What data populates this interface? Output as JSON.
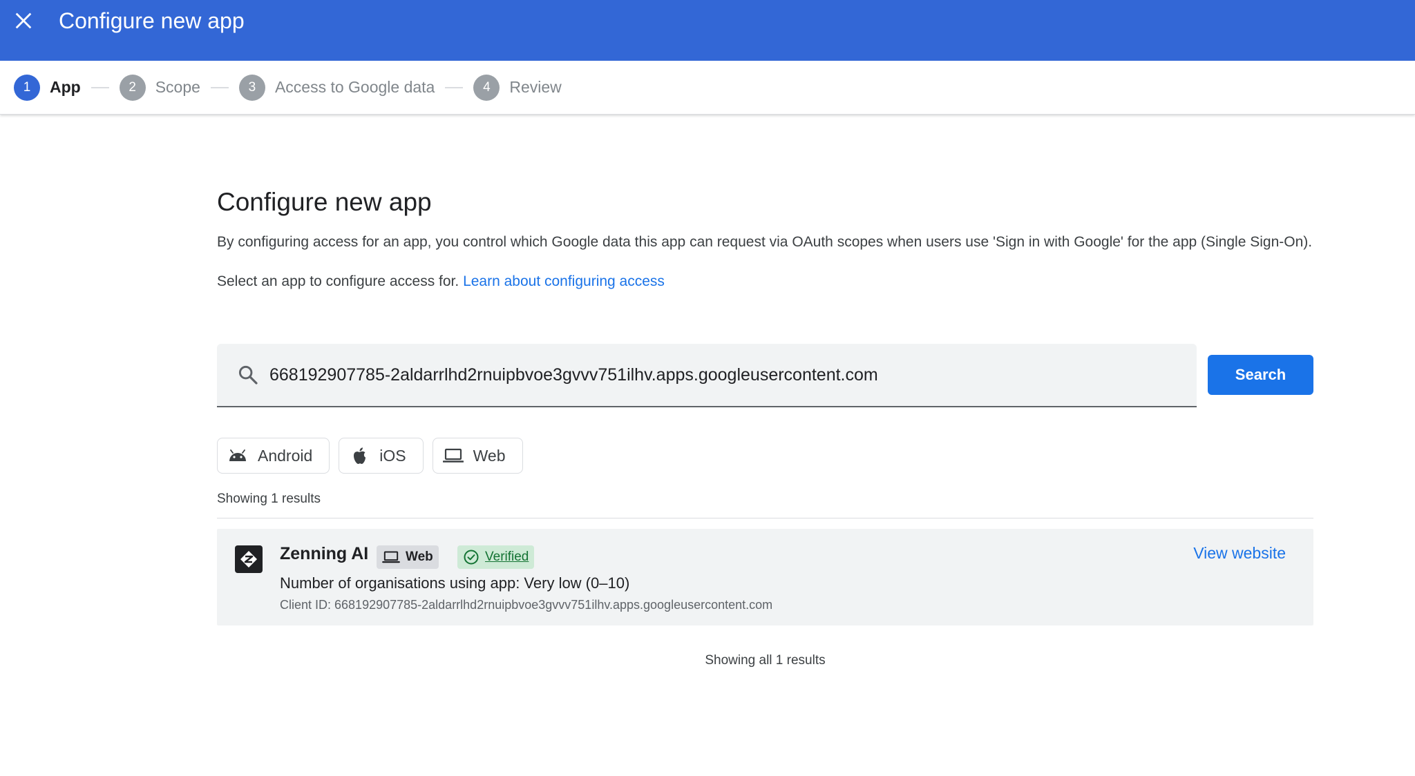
{
  "header": {
    "title": "Configure new app",
    "close_icon": "close-icon",
    "color": "#3367d6"
  },
  "stepper": {
    "steps": [
      {
        "number": "1",
        "label": "App",
        "active": true
      },
      {
        "number": "2",
        "label": "Scope",
        "active": false
      },
      {
        "number": "3",
        "label": "Access to Google data",
        "active": false
      },
      {
        "number": "4",
        "label": "Review",
        "active": false
      }
    ]
  },
  "main": {
    "title": "Configure new app",
    "description": "By configuring access for an app, you control which Google data this app can request via OAuth scopes when users use 'Sign in with Google' for the app (Single Sign-On).",
    "select_text": "Select an app to configure access for.",
    "learn_link": "Learn about configuring access"
  },
  "search": {
    "value": "668192907785-2aldarrlhd2rnuipbvoe3gvvv751ilhv.apps.googleusercontent.com",
    "icon": "search-icon",
    "button_label": "Search"
  },
  "filters": [
    {
      "label": "Android",
      "icon": "android-icon"
    },
    {
      "label": "iOS",
      "icon": "apple-icon"
    },
    {
      "label": "Web",
      "icon": "laptop-icon"
    }
  ],
  "results": {
    "showing_text": "Showing 1 results",
    "items": [
      {
        "name": "Zenning AI",
        "platform_badge": "Web",
        "verified_badge": "Verified",
        "orgs_text": "Number of organisations using app: Very low (0–10)",
        "client_id_text": "Client ID: 668192907785-2aldarrlhd2rnuipbvoe3gvvv751ilhv.apps.googleusercontent.com",
        "view_website_label": "View website"
      }
    ],
    "showing_all_text": "Showing all 1 results"
  },
  "colors": {
    "accent": "#1a73e8",
    "verified": "#137333"
  }
}
